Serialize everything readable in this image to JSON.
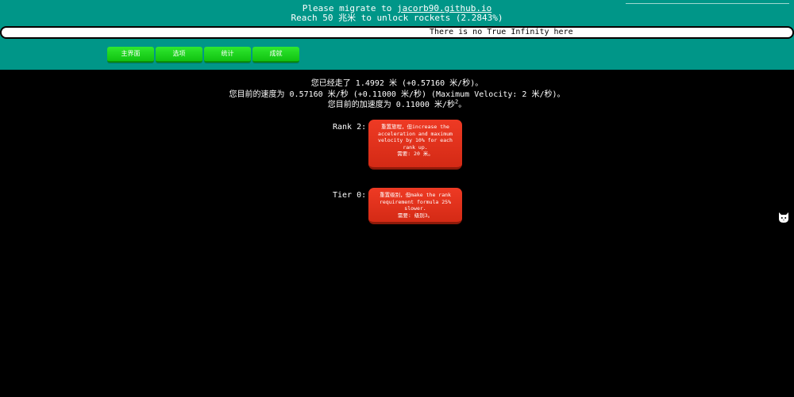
{
  "header": {
    "migrate_prefix": "Please migrate to ",
    "migrate_link": "jacorb90.github.io",
    "unlock_text": "Reach 50 兆米 to unlock rockets (2.2843%)"
  },
  "news": {
    "text": "There is no True Infinity here"
  },
  "tabs": [
    {
      "label": "主界面"
    },
    {
      "label": "选项"
    },
    {
      "label": "统计"
    },
    {
      "label": "成就"
    }
  ],
  "stats": {
    "distance": "您已经走了 1.4992 米 (+0.57160 米/秒)。",
    "velocity": "您目前的速度为 0.57160 米/秒 (+0.11000 米/秒) (Maximum Velocity: 2 米/秒)。",
    "acceleration_prefix": "您目前的加速度为 0.11000 米/秒",
    "acceleration_exp": "2",
    "acceleration_suffix": "。"
  },
  "rank": {
    "label": "Rank 2:",
    "description": "重置旅程，但increase the acceleration and maximum velocity by 10% for each rank up.",
    "requirement": "需要: 20 米。"
  },
  "tier": {
    "label": "Tier 0:",
    "description": "重置级别，但make the rank requirement formula 25% slower.",
    "requirement": "需要: 级别3。"
  },
  "colors": {
    "header_bg": "#009688",
    "tab_green": "#1fd41f",
    "reset_red": "#e2331d",
    "page_bg": "#000000"
  },
  "icons": {
    "side_icon": "github-cat-icon"
  }
}
